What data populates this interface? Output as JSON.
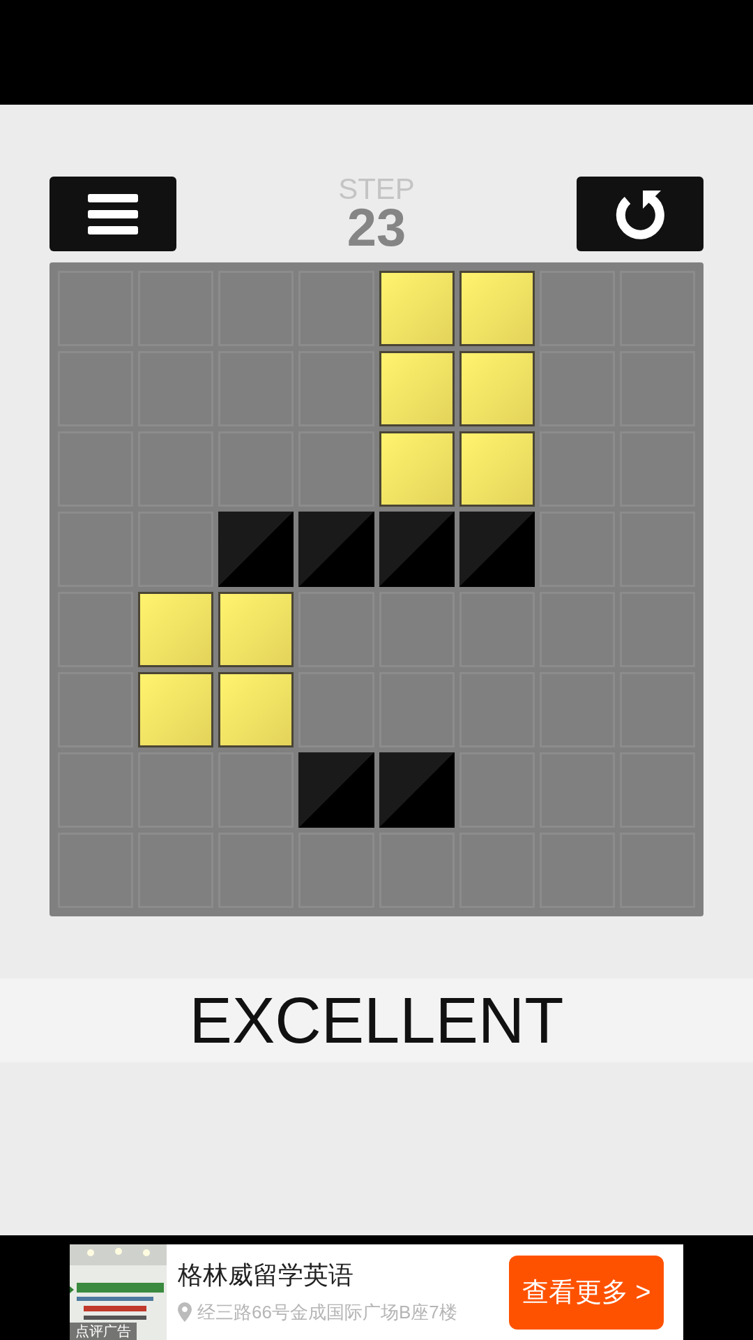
{
  "header": {
    "step_label": "STEP",
    "step_count": "23"
  },
  "board": {
    "rows": [
      [
        {
          "kind": "empty"
        },
        {
          "kind": "empty"
        },
        {
          "kind": "empty"
        },
        {
          "kind": "empty"
        },
        {
          "kind": "lit"
        },
        {
          "kind": "lit"
        },
        {
          "kind": "empty"
        },
        {
          "kind": "empty"
        }
      ],
      [
        {
          "kind": "empty"
        },
        {
          "kind": "empty"
        },
        {
          "kind": "empty"
        },
        {
          "kind": "empty"
        },
        {
          "kind": "lit"
        },
        {
          "kind": "lit"
        },
        {
          "kind": "empty"
        },
        {
          "kind": "empty"
        }
      ],
      [
        {
          "kind": "empty"
        },
        {
          "kind": "empty"
        },
        {
          "kind": "empty"
        },
        {
          "kind": "empty"
        },
        {
          "kind": "lit"
        },
        {
          "kind": "lit"
        },
        {
          "kind": "empty"
        },
        {
          "kind": "empty"
        }
      ],
      [
        {
          "kind": "empty"
        },
        {
          "kind": "empty"
        },
        {
          "kind": "wall"
        },
        {
          "kind": "wall"
        },
        {
          "kind": "wall"
        },
        {
          "kind": "wall"
        },
        {
          "kind": "empty"
        },
        {
          "kind": "empty"
        }
      ],
      [
        {
          "kind": "empty"
        },
        {
          "kind": "lit"
        },
        {
          "kind": "lit"
        },
        {
          "kind": "empty"
        },
        {
          "kind": "empty"
        },
        {
          "kind": "empty"
        },
        {
          "kind": "empty"
        },
        {
          "kind": "empty"
        }
      ],
      [
        {
          "kind": "empty"
        },
        {
          "kind": "lit"
        },
        {
          "kind": "lit"
        },
        {
          "kind": "empty"
        },
        {
          "kind": "empty"
        },
        {
          "kind": "empty"
        },
        {
          "kind": "empty"
        },
        {
          "kind": "empty"
        }
      ],
      [
        {
          "kind": "empty"
        },
        {
          "kind": "empty"
        },
        {
          "kind": "empty"
        },
        {
          "kind": "wall"
        },
        {
          "kind": "wall"
        },
        {
          "kind": "empty"
        },
        {
          "kind": "empty"
        },
        {
          "kind": "empty"
        }
      ],
      [
        {
          "kind": "empty"
        },
        {
          "kind": "empty"
        },
        {
          "kind": "empty"
        },
        {
          "kind": "empty"
        },
        {
          "kind": "empty"
        },
        {
          "kind": "empty"
        },
        {
          "kind": "empty"
        },
        {
          "kind": "empty"
        }
      ]
    ]
  },
  "rating": "EXCELLENT",
  "ad": {
    "badge": "点评广告",
    "title": "格林威留学英语",
    "address": "经三路66号金成国际广场B座7楼",
    "button": "查看更多 >"
  }
}
